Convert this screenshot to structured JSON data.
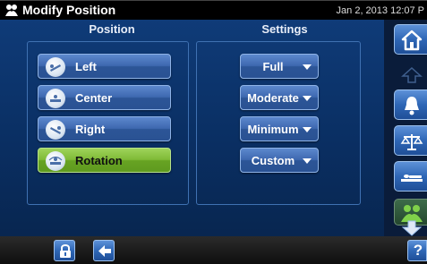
{
  "window": {
    "title": "Modify Position",
    "datetime": "Jan 2, 2013 12:07 P"
  },
  "columns": {
    "position_header": "Position",
    "settings_header": "Settings"
  },
  "positions": [
    {
      "label": "Left",
      "icon": "bed-tilt-left-icon",
      "active": false
    },
    {
      "label": "Center",
      "icon": "bed-center-icon",
      "active": false
    },
    {
      "label": "Right",
      "icon": "bed-tilt-right-icon",
      "active": false
    },
    {
      "label": "Rotation",
      "icon": "bed-rotation-icon",
      "active": true
    }
  ],
  "settings": [
    {
      "label": "Full",
      "icon": "chevron-down-icon"
    },
    {
      "label": "Moderate",
      "icon": "chevron-down-icon"
    },
    {
      "label": "Minimum",
      "icon": "chevron-down-icon"
    },
    {
      "label": "Custom",
      "icon": "chevron-down-icon"
    }
  ],
  "sidebar": {
    "items": [
      "home-icon",
      "scroll-up-icon",
      "bell-icon",
      "scale-icon",
      "bed-icon",
      "patient-icon",
      "scroll-down-icon"
    ]
  },
  "bottombar": {
    "help_label": "?",
    "items": [
      "lock-icon",
      "back-arrow-icon",
      "help-icon"
    ]
  },
  "colors": {
    "accent_blue": "#3e68b0",
    "active_green": "#7fba36",
    "background": "#0a2f63"
  }
}
